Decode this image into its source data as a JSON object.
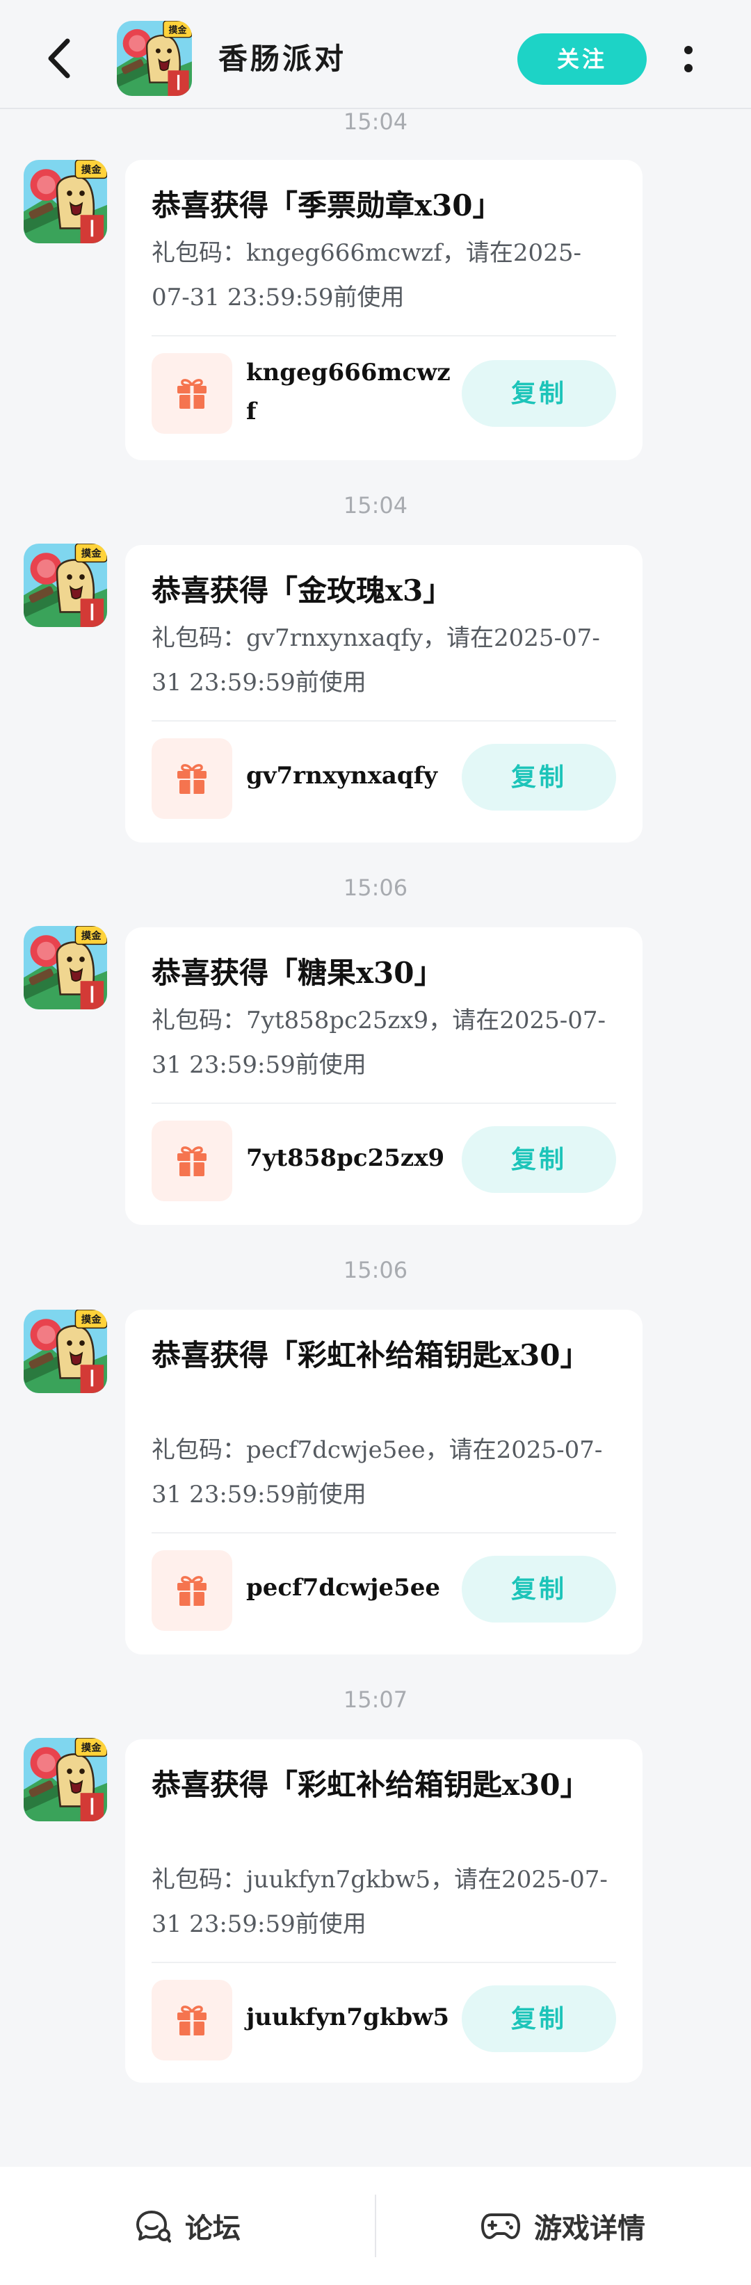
{
  "header": {
    "title": "香肠派对",
    "follow_label": "关注",
    "badge_text": "摸金"
  },
  "messages": [
    {
      "time": "15:04",
      "title": "恭喜获得「季票勋章x30」",
      "desc": "礼包码：kngeg666mcwzf，请在2025-07-31 23:59:59前使用",
      "code": "kngeg666mcwzf",
      "copy_label": "复制"
    },
    {
      "time": "15:04",
      "title": "恭喜获得「金玫瑰x3」",
      "desc": "礼包码：gv7rnxynxaqfy，请在2025-07-31 23:59:59前使用",
      "code": "gv7rnxynxaqfy",
      "copy_label": "复制"
    },
    {
      "time": "15:06",
      "title": "恭喜获得「糖果x30」",
      "desc": "礼包码：7yt858pc25zx9，请在2025-07-31 23:59:59前使用",
      "code": "7yt858pc25zx9",
      "copy_label": "复制"
    },
    {
      "time": "15:06",
      "title": "恭喜获得「彩虹补给箱钥匙x30」",
      "desc": "礼包码：pecf7dcwje5ee，请在2025-07-31 23:59:59前使用",
      "code": "pecf7dcwje5ee",
      "copy_label": "复制"
    },
    {
      "time": "15:07",
      "title": "恭喜获得「彩虹补给箱钥匙x30」",
      "desc": "礼包码：juukfyn7gkbw5，请在2025-07-31 23:59:59前使用",
      "code": "juukfyn7gkbw5",
      "copy_label": "复制"
    }
  ],
  "bottom_bar": {
    "forum_label": "论坛",
    "game_detail_label": "游戏详情"
  },
  "colors": {
    "accent": "#1dd3c6",
    "copy_bg": "#e3f8f7",
    "gift": "#f5744f",
    "background": "#f5f6f8"
  },
  "icons": {
    "back": "chevron-left-icon",
    "more": "vertical-dots-icon",
    "gift": "gift-icon",
    "forum": "chat-bubble-icon",
    "game": "gamepad-icon"
  }
}
